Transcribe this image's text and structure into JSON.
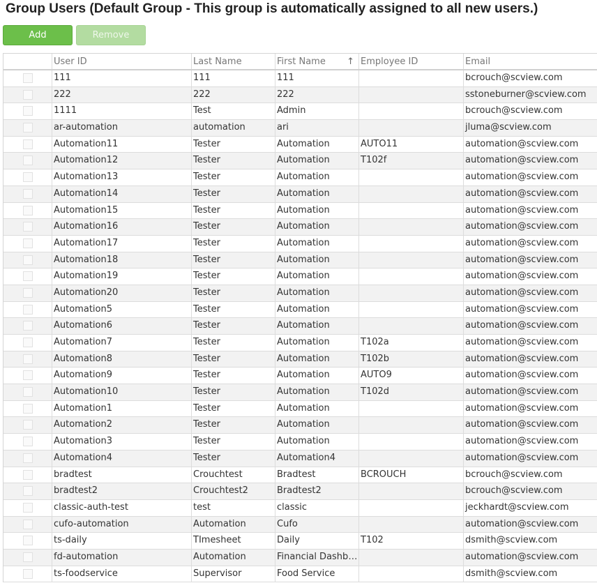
{
  "title": "Group Users (Default Group - This group is automatically assigned to all new users.)",
  "buttons": {
    "add": "Add",
    "remove": "Remove"
  },
  "columns": [
    "",
    "User ID",
    "Last Name",
    "First Name",
    "Employee ID",
    "Email"
  ],
  "sort_icon": "↑",
  "rows": [
    [
      "111",
      "111",
      "111",
      "",
      "bcrouch@scview.com"
    ],
    [
      "222",
      "222",
      "222",
      "",
      "sstoneburner@scview.com"
    ],
    [
      "1111",
      "Test",
      "Admin",
      "",
      "bcrouch@scview.com"
    ],
    [
      "ar-automation",
      "automation",
      "ari",
      "",
      "jluma@scview.com"
    ],
    [
      "Automation11",
      "Tester",
      "Automation",
      "AUTO11",
      "automation@scview.com"
    ],
    [
      "Automation12",
      "Tester",
      "Automation",
      "T102f",
      "automation@scview.com"
    ],
    [
      "Automation13",
      "Tester",
      "Automation",
      "",
      "automation@scview.com"
    ],
    [
      "Automation14",
      "Tester",
      "Automation",
      "",
      "automation@scview.com"
    ],
    [
      "Automation15",
      "Tester",
      "Automation",
      "",
      "automation@scview.com"
    ],
    [
      "Automation16",
      "Tester",
      "Automation",
      "",
      "automation@scview.com"
    ],
    [
      "Automation17",
      "Tester",
      "Automation",
      "",
      "automation@scview.com"
    ],
    [
      "Automation18",
      "Tester",
      "Automation",
      "",
      "automation@scview.com"
    ],
    [
      "Automation19",
      "Tester",
      "Automation",
      "",
      "automation@scview.com"
    ],
    [
      "Automation20",
      "Tester",
      "Automation",
      "",
      "automation@scview.com"
    ],
    [
      "Automation5",
      "Tester",
      "Automation",
      "",
      "automation@scview.com"
    ],
    [
      "Automation6",
      "Tester",
      "Automation",
      "",
      "automation@scview.com"
    ],
    [
      "Automation7",
      "Tester",
      "Automation",
      "T102a",
      "automation@scview.com"
    ],
    [
      "Automation8",
      "Tester",
      "Automation",
      "T102b",
      "automation@scview.com"
    ],
    [
      "Automation9",
      "Tester",
      "Automation",
      "AUTO9",
      "automation@scview.com"
    ],
    [
      "Automation10",
      "Tester",
      "Automation",
      "T102d",
      "automation@scview.com"
    ],
    [
      "Automation1",
      "Tester",
      "Automation",
      "",
      "automation@scview.com"
    ],
    [
      "Automation2",
      "Tester",
      "Automation",
      "",
      "automation@scview.com"
    ],
    [
      "Automation3",
      "Tester",
      "Automation",
      "",
      "automation@scview.com"
    ],
    [
      "Automation4",
      "Tester",
      "Automation4",
      "",
      "automation@scview.com"
    ],
    [
      "bradtest",
      "Crouchtest",
      "Bradtest",
      "BCROUCH",
      "bcrouch@scview.com"
    ],
    [
      "bradtest2",
      "Crouchtest2",
      "Bradtest2",
      "",
      "bcrouch@scview.com"
    ],
    [
      "classic-auth-test",
      "test",
      "classic",
      "",
      "jeckhardt@scview.com"
    ],
    [
      "cufo-automation",
      "Automation",
      "Cufo",
      "",
      "automation@scview.com"
    ],
    [
      "ts-daily",
      "TImesheet",
      "Daily",
      "T102",
      "dsmith@scview.com"
    ],
    [
      "fd-automation",
      "Automation",
      "Financial Dashbo…",
      "",
      "automation@scview.com"
    ],
    [
      "ts-foodservice",
      "Supervisor",
      "Food Service",
      "",
      "dsmith@scview.com"
    ]
  ]
}
